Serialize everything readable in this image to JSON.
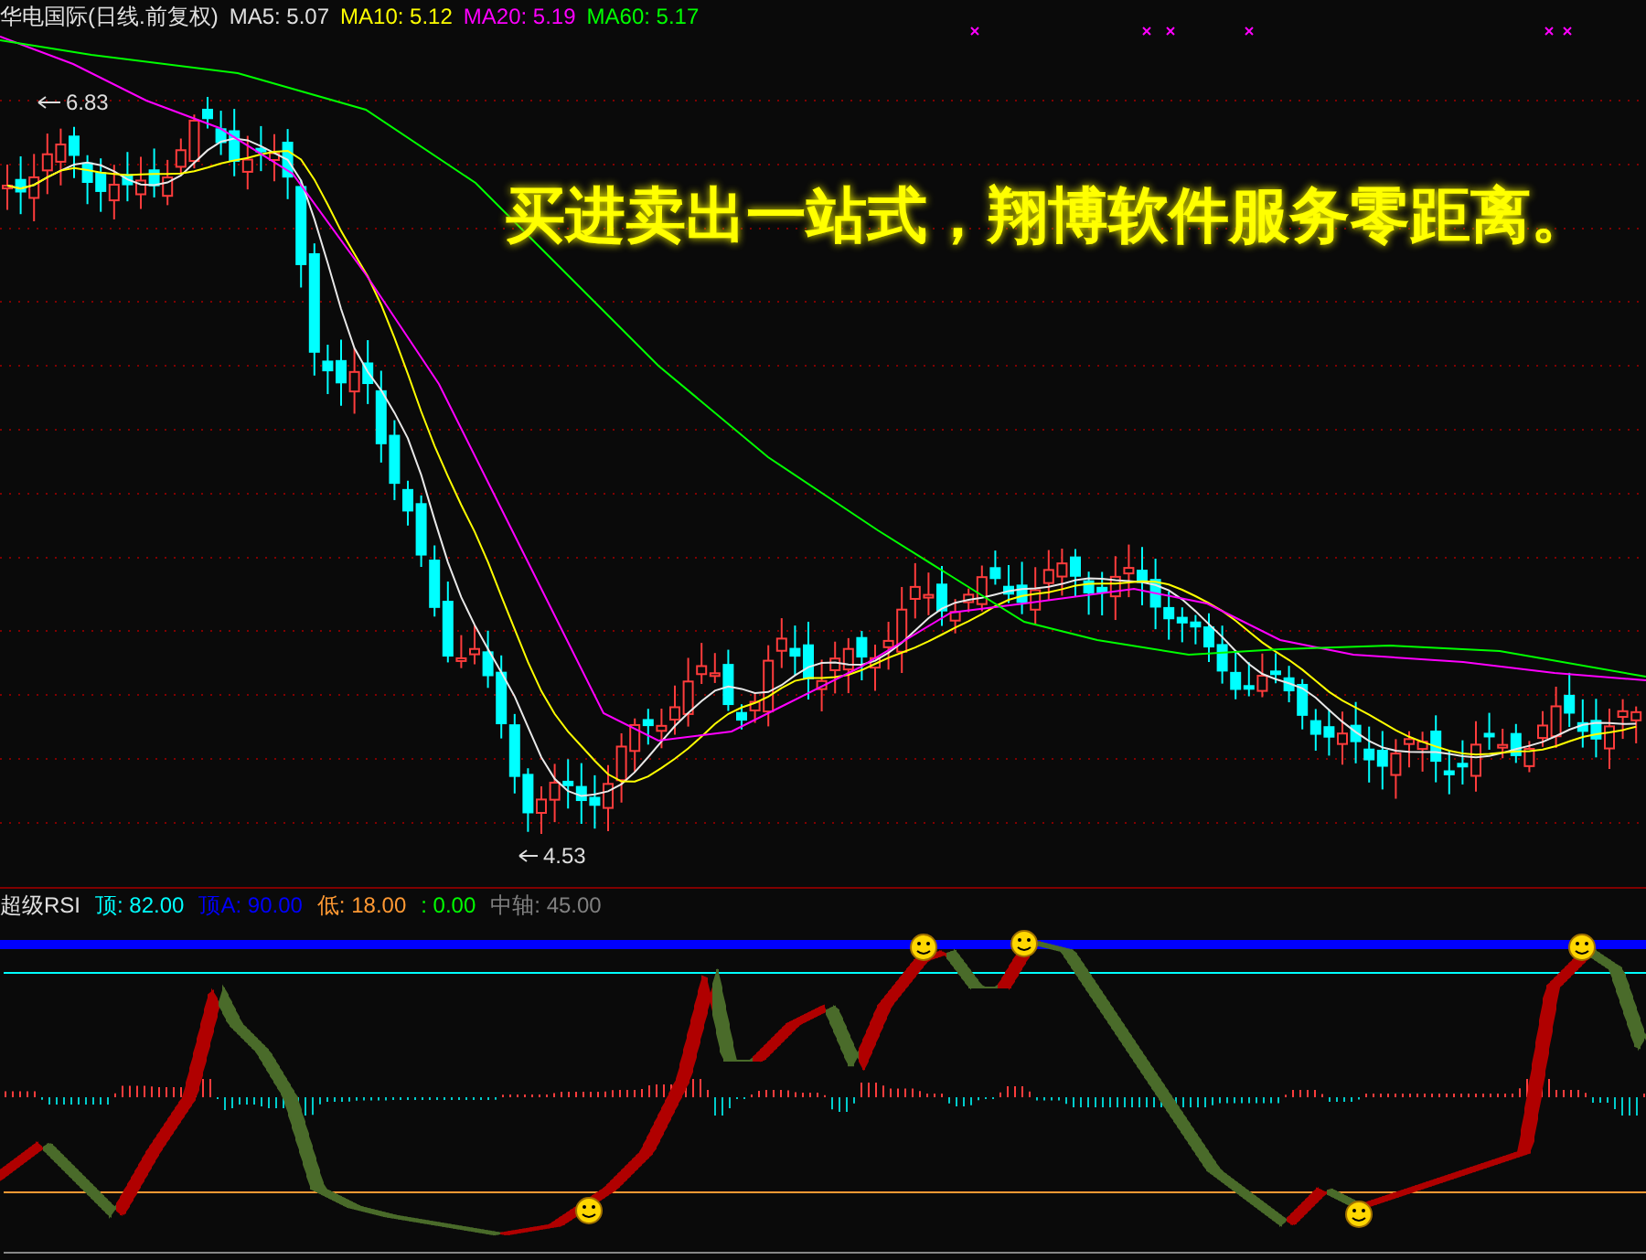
{
  "price_panel": {
    "legend": [
      {
        "text": "华电国际(日线.前复权)",
        "color": "#e0e0e0"
      },
      {
        "text": "MA5: 5.07",
        "color": "#e0e0e0"
      },
      {
        "text": "MA10: 5.12",
        "color": "#ffff00"
      },
      {
        "text": "MA20: 5.19",
        "color": "#ff00ff"
      },
      {
        "text": "MA60: 5.17",
        "color": "#00ff00"
      }
    ],
    "high_label": "6.83",
    "low_label": "4.53",
    "banner": "买进卖出一站式，翔博软件服务零距离。"
  },
  "rsi_panel": {
    "legend": [
      {
        "text": "超级RSI",
        "color": "#e0e0e0"
      },
      {
        "text": "顶: 82.00",
        "color": "#00ffff"
      },
      {
        "text": "顶A: 90.00",
        "color": "#0000ff"
      },
      {
        "text": "低: 18.00",
        "color": "#ff9933"
      },
      {
        "text": ": 0.00",
        "color": "#00ff00"
      },
      {
        "text": "中轴: 45.00",
        "color": "#808080"
      }
    ]
  }
}
